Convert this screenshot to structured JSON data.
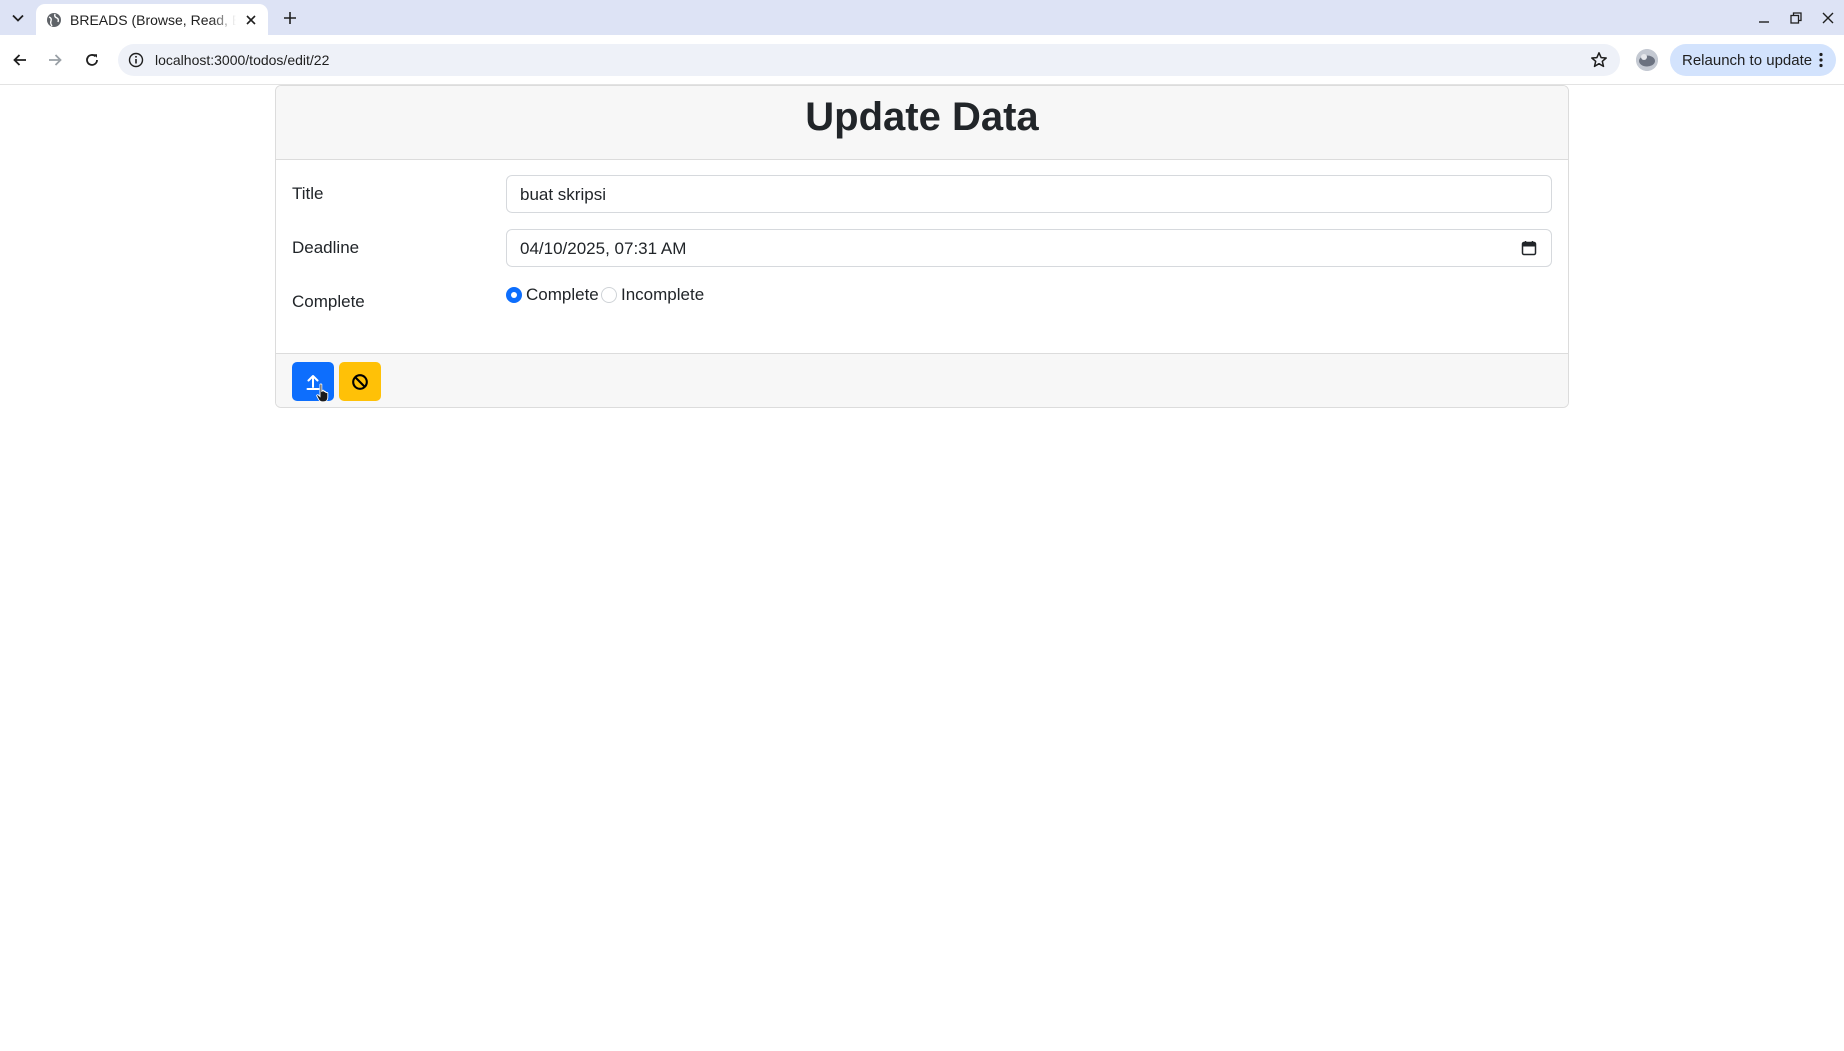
{
  "browser": {
    "tab": {
      "title": "BREADS (Browse, Read, Edit, Add, Delete, Sort)",
      "favicon": "globe-icon"
    },
    "address": {
      "url": "localhost:3000/todos/edit/22"
    },
    "relaunch_label": "Relaunch to update"
  },
  "page": {
    "heading": "Update Data",
    "form": {
      "title": {
        "label": "Title",
        "value": "buat skripsi"
      },
      "deadline": {
        "label": "Deadline",
        "value": "04/10/2025, 07:31 AM"
      },
      "complete": {
        "label": "Complete",
        "options": [
          {
            "label": "Complete",
            "checked": true
          },
          {
            "label": "Incomplete",
            "checked": false
          }
        ]
      }
    },
    "buttons": {
      "submit": {
        "icon": "upload-icon",
        "color": "#0d6efd"
      },
      "cancel": {
        "icon": "ban-icon",
        "color": "#ffc107"
      }
    }
  }
}
